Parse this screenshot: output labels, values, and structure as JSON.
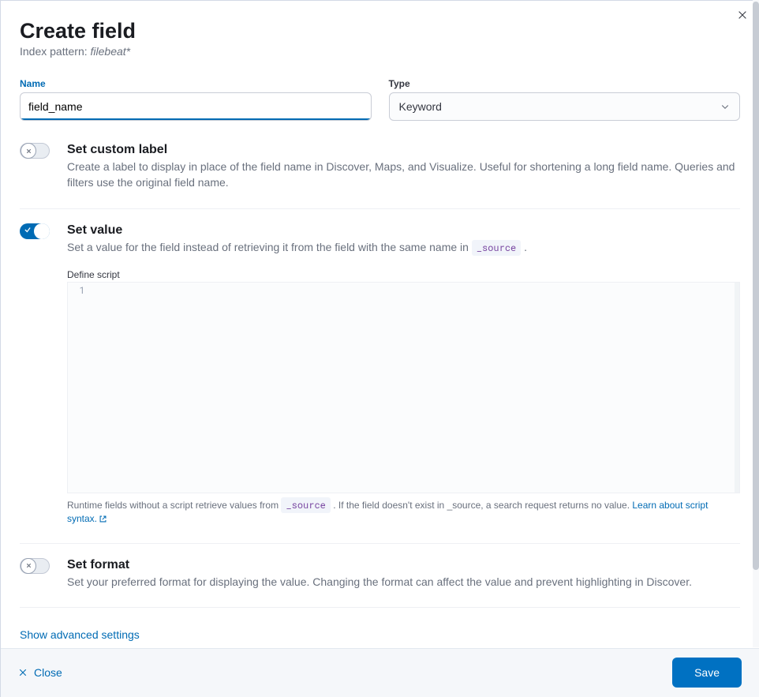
{
  "header": {
    "title": "Create field",
    "index_pattern_label": "Index pattern:",
    "index_pattern_value": "filebeat*"
  },
  "name_field": {
    "label": "Name",
    "value": "field_name"
  },
  "type_field": {
    "label": "Type",
    "selected": "Keyword"
  },
  "custom_label": {
    "title": "Set custom label",
    "desc": "Create a label to display in place of the field name in Discover, Maps, and Visualize. Useful for shortening a long field name. Queries and filters use the original field name."
  },
  "set_value": {
    "title": "Set value",
    "desc_pre": "Set a value for the field instead of retrieving it from the field with the same name in ",
    "desc_code": "_source",
    "desc_post": " .",
    "script_label": "Define script",
    "line_no": "1",
    "help_pre": "Runtime fields without a script retrieve values from ",
    "help_code": "_source",
    "help_post": " . If the field doesn't exist in _source, a search request returns no value. ",
    "help_link": "Learn about script syntax."
  },
  "set_format": {
    "title": "Set format",
    "desc": "Set your preferred format for displaying the value. Changing the format can affect the value and prevent highlighting in Discover."
  },
  "advanced_link": "Show advanced settings",
  "footer": {
    "close": "Close",
    "save": "Save"
  }
}
